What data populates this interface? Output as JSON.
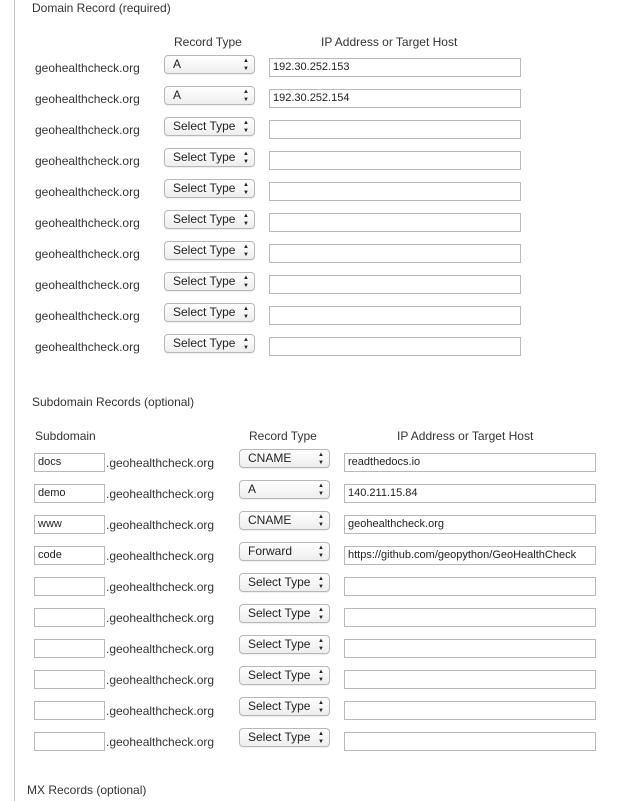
{
  "domain_section": {
    "title": "Domain Record (required)",
    "col_record_type": "Record Type",
    "col_target": "IP Address or Target Host",
    "rows": [
      {
        "domain": "geohealthcheck.org",
        "type": "A",
        "target": ""
      },
      {
        "domain": "geohealthcheck.org",
        "type": "A",
        "target": ""
      },
      {
        "domain": "geohealthcheck.org",
        "type": "Select Type",
        "target": ""
      },
      {
        "domain": "geohealthcheck.org",
        "type": "Select Type",
        "target": ""
      },
      {
        "domain": "geohealthcheck.org",
        "type": "Select Type",
        "target": ""
      },
      {
        "domain": "geohealthcheck.org",
        "type": "Select Type",
        "target": ""
      },
      {
        "domain": "geohealthcheck.org",
        "type": "Select Type",
        "target": ""
      },
      {
        "domain": "geohealthcheck.org",
        "type": "Select Type",
        "target": ""
      },
      {
        "domain": "geohealthcheck.org",
        "type": "Select Type",
        "target": ""
      },
      {
        "domain": "geohealthcheck.org",
        "type": "Select Type",
        "target": ""
      }
    ]
  },
  "subdomain_section": {
    "title": "Subdomain Records (optional)",
    "col_subdomain": "Subdomain",
    "col_record_type": "Record Type",
    "col_target": "IP Address or Target Host",
    "suffix": ".geohealthcheck.org",
    "rows": [
      {
        "subdomain": "docs",
        "type": "CNAME",
        "target": "readthedocs.io"
      },
      {
        "subdomain": "demo",
        "type": "A",
        "target": "140.211.15.84"
      },
      {
        "subdomain": "www",
        "type": "CNAME",
        "target": "geohealthcheck.org"
      },
      {
        "subdomain": "code",
        "type": "Forward",
        "target": "https://github.com/geopython/GeoHealthCheck"
      },
      {
        "subdomain": "",
        "type": "Select Type",
        "target": ""
      },
      {
        "subdomain": "",
        "type": "Select Type",
        "target": ""
      },
      {
        "subdomain": "",
        "type": "Select Type",
        "target": ""
      },
      {
        "subdomain": "",
        "type": "Select Type",
        "target": ""
      },
      {
        "subdomain": "",
        "type": "Select Type",
        "target": ""
      },
      {
        "subdomain": "",
        "type": "Select Type",
        "target": ""
      }
    ]
  },
  "domain_targets_first": [
    "192.30.252.153",
    "192.30.252.154"
  ],
  "mx_section": {
    "title": "MX Records (optional)"
  },
  "icons": {
    "select_arrows": "updown-chevron-icon"
  }
}
